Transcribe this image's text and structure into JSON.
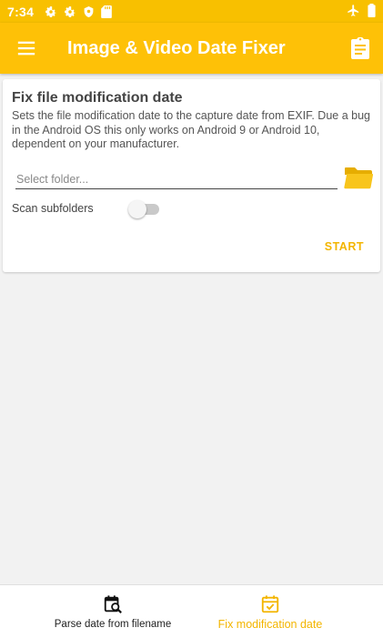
{
  "status_bar": {
    "time": "7:34",
    "left_icons": [
      "gear-icon",
      "gear-icon",
      "shield-icon",
      "sd-card-icon"
    ],
    "right_icons": [
      "airplane-icon",
      "battery-icon"
    ]
  },
  "app_bar": {
    "title": "Image & Video Date Fixer",
    "color": "#fec107"
  },
  "card": {
    "title": "Fix file modification date",
    "description": "Sets the file modification date to the capture date from EXIF. Due a bug in the Android OS this only works on Android 9 or Android 10, dependent on your manufacturer.",
    "folder_placeholder": "Select folder...",
    "folder_value": "",
    "scan_subfolders_label": "Scan subfolders",
    "scan_subfolders_on": false,
    "start_label": "START"
  },
  "bottom_nav": {
    "items": [
      {
        "label": "Parse date from filename",
        "icon": "calendar-search-icon",
        "active": false
      },
      {
        "label": "Fix modification date",
        "icon": "calendar-check-icon",
        "active": true
      }
    ],
    "active_color": "#f3b500"
  }
}
